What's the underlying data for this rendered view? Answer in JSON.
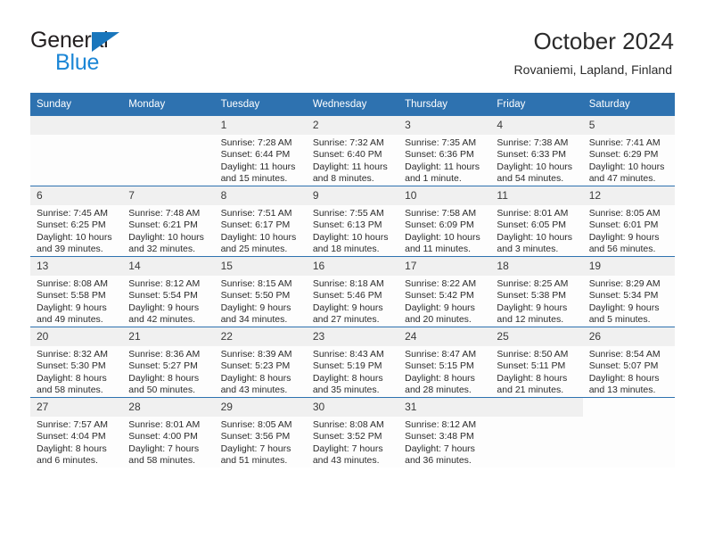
{
  "brand": {
    "word_one": "General",
    "word_two": "Blue",
    "triangle_icon": "brand-triangle-icon"
  },
  "header": {
    "title": "October 2024",
    "subtitle": "Rovaniemi, Lapland, Finland"
  },
  "colors": {
    "header_blue": "#2e72b0",
    "brand_blue": "#1b86d6",
    "brand_triangle": "#1976bc",
    "daynum_band": "#f0f0f0",
    "text": "#2b2b2b"
  },
  "weekday_headers": [
    "Sunday",
    "Monday",
    "Tuesday",
    "Wednesday",
    "Thursday",
    "Friday",
    "Saturday"
  ],
  "weeks": [
    [
      {
        "day": "",
        "details": ""
      },
      {
        "day": "",
        "details": ""
      },
      {
        "day": "1",
        "details": "Sunrise: 7:28 AM\nSunset: 6:44 PM\nDaylight: 11 hours\nand 15 minutes."
      },
      {
        "day": "2",
        "details": "Sunrise: 7:32 AM\nSunset: 6:40 PM\nDaylight: 11 hours\nand 8 minutes."
      },
      {
        "day": "3",
        "details": "Sunrise: 7:35 AM\nSunset: 6:36 PM\nDaylight: 11 hours\nand 1 minute."
      },
      {
        "day": "4",
        "details": "Sunrise: 7:38 AM\nSunset: 6:33 PM\nDaylight: 10 hours\nand 54 minutes."
      },
      {
        "day": "5",
        "details": "Sunrise: 7:41 AM\nSunset: 6:29 PM\nDaylight: 10 hours\nand 47 minutes."
      }
    ],
    [
      {
        "day": "6",
        "details": "Sunrise: 7:45 AM\nSunset: 6:25 PM\nDaylight: 10 hours\nand 39 minutes."
      },
      {
        "day": "7",
        "details": "Sunrise: 7:48 AM\nSunset: 6:21 PM\nDaylight: 10 hours\nand 32 minutes."
      },
      {
        "day": "8",
        "details": "Sunrise: 7:51 AM\nSunset: 6:17 PM\nDaylight: 10 hours\nand 25 minutes."
      },
      {
        "day": "9",
        "details": "Sunrise: 7:55 AM\nSunset: 6:13 PM\nDaylight: 10 hours\nand 18 minutes."
      },
      {
        "day": "10",
        "details": "Sunrise: 7:58 AM\nSunset: 6:09 PM\nDaylight: 10 hours\nand 11 minutes."
      },
      {
        "day": "11",
        "details": "Sunrise: 8:01 AM\nSunset: 6:05 PM\nDaylight: 10 hours\nand 3 minutes."
      },
      {
        "day": "12",
        "details": "Sunrise: 8:05 AM\nSunset: 6:01 PM\nDaylight: 9 hours\nand 56 minutes."
      }
    ],
    [
      {
        "day": "13",
        "details": "Sunrise: 8:08 AM\nSunset: 5:58 PM\nDaylight: 9 hours\nand 49 minutes."
      },
      {
        "day": "14",
        "details": "Sunrise: 8:12 AM\nSunset: 5:54 PM\nDaylight: 9 hours\nand 42 minutes."
      },
      {
        "day": "15",
        "details": "Sunrise: 8:15 AM\nSunset: 5:50 PM\nDaylight: 9 hours\nand 34 minutes."
      },
      {
        "day": "16",
        "details": "Sunrise: 8:18 AM\nSunset: 5:46 PM\nDaylight: 9 hours\nand 27 minutes."
      },
      {
        "day": "17",
        "details": "Sunrise: 8:22 AM\nSunset: 5:42 PM\nDaylight: 9 hours\nand 20 minutes."
      },
      {
        "day": "18",
        "details": "Sunrise: 8:25 AM\nSunset: 5:38 PM\nDaylight: 9 hours\nand 12 minutes."
      },
      {
        "day": "19",
        "details": "Sunrise: 8:29 AM\nSunset: 5:34 PM\nDaylight: 9 hours\nand 5 minutes."
      }
    ],
    [
      {
        "day": "20",
        "details": "Sunrise: 8:32 AM\nSunset: 5:30 PM\nDaylight: 8 hours\nand 58 minutes."
      },
      {
        "day": "21",
        "details": "Sunrise: 8:36 AM\nSunset: 5:27 PM\nDaylight: 8 hours\nand 50 minutes."
      },
      {
        "day": "22",
        "details": "Sunrise: 8:39 AM\nSunset: 5:23 PM\nDaylight: 8 hours\nand 43 minutes."
      },
      {
        "day": "23",
        "details": "Sunrise: 8:43 AM\nSunset: 5:19 PM\nDaylight: 8 hours\nand 35 minutes."
      },
      {
        "day": "24",
        "details": "Sunrise: 8:47 AM\nSunset: 5:15 PM\nDaylight: 8 hours\nand 28 minutes."
      },
      {
        "day": "25",
        "details": "Sunrise: 8:50 AM\nSunset: 5:11 PM\nDaylight: 8 hours\nand 21 minutes."
      },
      {
        "day": "26",
        "details": "Sunrise: 8:54 AM\nSunset: 5:07 PM\nDaylight: 8 hours\nand 13 minutes."
      }
    ],
    [
      {
        "day": "27",
        "details": "Sunrise: 7:57 AM\nSunset: 4:04 PM\nDaylight: 8 hours\nand 6 minutes."
      },
      {
        "day": "28",
        "details": "Sunrise: 8:01 AM\nSunset: 4:00 PM\nDaylight: 7 hours\nand 58 minutes."
      },
      {
        "day": "29",
        "details": "Sunrise: 8:05 AM\nSunset: 3:56 PM\nDaylight: 7 hours\nand 51 minutes."
      },
      {
        "day": "30",
        "details": "Sunrise: 8:08 AM\nSunset: 3:52 PM\nDaylight: 7 hours\nand 43 minutes."
      },
      {
        "day": "31",
        "details": "Sunrise: 8:12 AM\nSunset: 3:48 PM\nDaylight: 7 hours\nand 36 minutes."
      },
      {
        "day": "",
        "details": ""
      },
      {
        "day": "",
        "details": "",
        "no_band": true
      }
    ]
  ]
}
